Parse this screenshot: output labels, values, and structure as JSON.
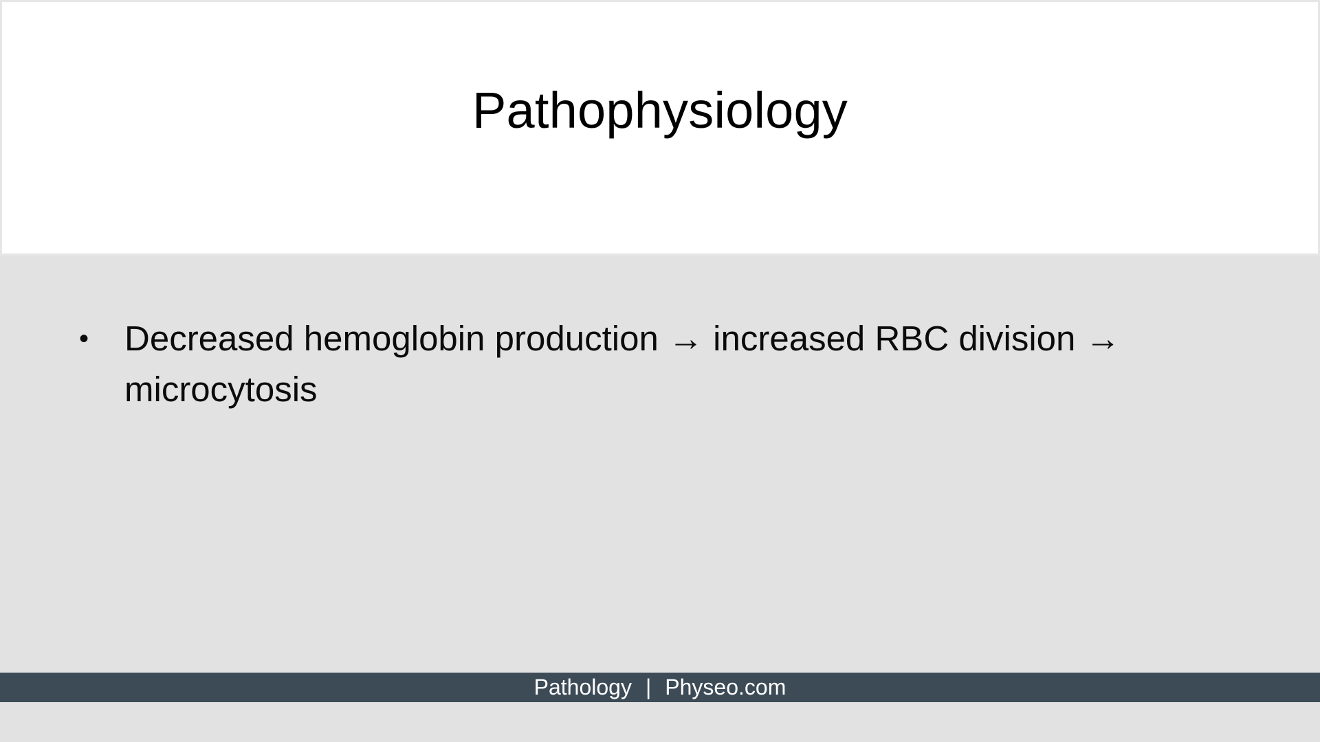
{
  "slide": {
    "title": "Pathophysiology",
    "bullets": [
      {
        "marker": "•",
        "text": "Decreased hemoglobin production → increased RBC division → microcytosis"
      }
    ]
  },
  "footer": {
    "left_text": "Pathology",
    "separator": "|",
    "right_text": "Physeo.com"
  },
  "colors": {
    "title_background": "#ffffff",
    "body_background": "#e2e2e2",
    "footer_background": "#3d4b57",
    "footer_text": "#ffffff"
  }
}
